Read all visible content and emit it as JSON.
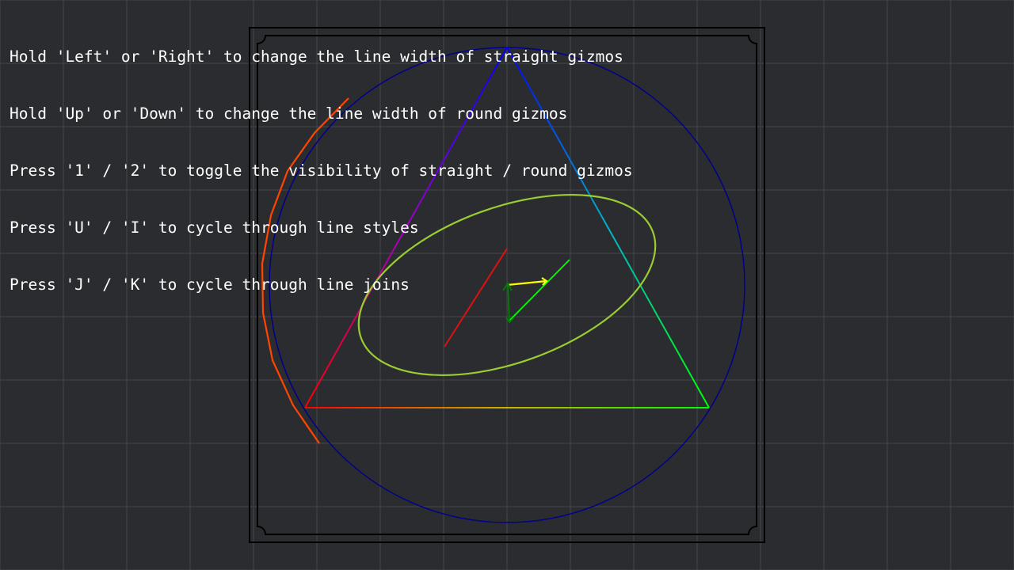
{
  "instructions": [
    "Hold 'Left' or 'Right' to change the line width of straight gizmos",
    "Hold 'Up' or 'Down' to change the line width of round gizmos",
    "Press '1' / '2' to toggle the visibility of straight / round gizmos",
    "Press 'U' / 'I' to cycle through line styles",
    "Press 'J' / 'K' to cycle through line joins"
  ],
  "colors": {
    "background": "#2b2c2f",
    "grid": "#3d3e42",
    "frame": "#000000",
    "circle": "#00008b",
    "ellipse": "#9acd32",
    "arc": "#ff4500",
    "red_line": "#dd1111",
    "green_line": "#00ff00",
    "yellow_arrow": "#ffff00",
    "dark_green_arrow": "#008000",
    "triangle_gradient": [
      "#0000ff",
      "#ff0000",
      "#00ff00"
    ]
  }
}
